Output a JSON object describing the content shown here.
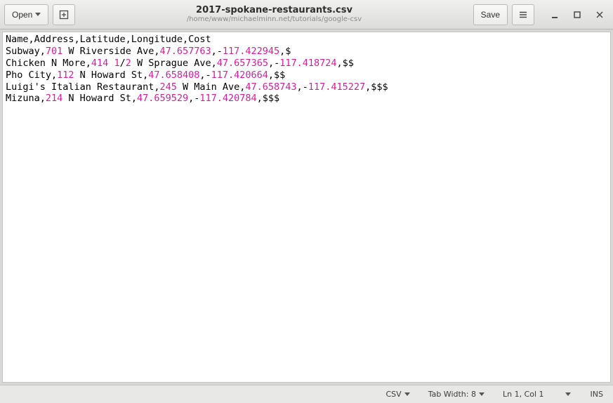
{
  "header": {
    "open_label": "Open",
    "save_label": "Save",
    "title": "2017-spokane-restaurants.csv",
    "subtitle": "/home/www/michaelminn.net/tutorials/google-csv"
  },
  "editor": {
    "lines": [
      [
        {
          "t": "Name,Address,Latitude,Longitude,Cost"
        }
      ],
      [
        {
          "t": "Subway,"
        },
        {
          "t": "701",
          "n": true
        },
        {
          "t": " W Riverside Ave,"
        },
        {
          "t": "47.657763",
          "n": true
        },
        {
          "t": ",-"
        },
        {
          "t": "117.422945",
          "n": true
        },
        {
          "t": ",$"
        }
      ],
      [
        {
          "t": "Chicken N More,"
        },
        {
          "t": "414",
          "n": true
        },
        {
          "t": " "
        },
        {
          "t": "1",
          "n": true
        },
        {
          "t": "/"
        },
        {
          "t": "2",
          "n": true
        },
        {
          "t": " W Sprague Ave,"
        },
        {
          "t": "47.657365",
          "n": true
        },
        {
          "t": ",-"
        },
        {
          "t": "117.418724",
          "n": true
        },
        {
          "t": ",$$"
        }
      ],
      [
        {
          "t": "Pho City,"
        },
        {
          "t": "112",
          "n": true
        },
        {
          "t": " N Howard St,"
        },
        {
          "t": "47.658408",
          "n": true
        },
        {
          "t": ",-"
        },
        {
          "t": "117.420664",
          "n": true
        },
        {
          "t": ",$$"
        }
      ],
      [
        {
          "t": "Luigi's Italian Restaurant,"
        },
        {
          "t": "245",
          "n": true
        },
        {
          "t": " W Main Ave,"
        },
        {
          "t": "47.658743",
          "n": true
        },
        {
          "t": ",-"
        },
        {
          "t": "117.415227",
          "n": true
        },
        {
          "t": ",$$$"
        }
      ],
      [
        {
          "t": "Mizuna,"
        },
        {
          "t": "214",
          "n": true
        },
        {
          "t": " N Howard St,"
        },
        {
          "t": "47.659529",
          "n": true
        },
        {
          "t": ",-"
        },
        {
          "t": "117.420784",
          "n": true
        },
        {
          "t": ",$$$"
        }
      ]
    ]
  },
  "status": {
    "lang": "CSV",
    "tab_width": "Tab Width: 8",
    "cursor": "Ln 1, Col 1",
    "insert": "INS"
  }
}
